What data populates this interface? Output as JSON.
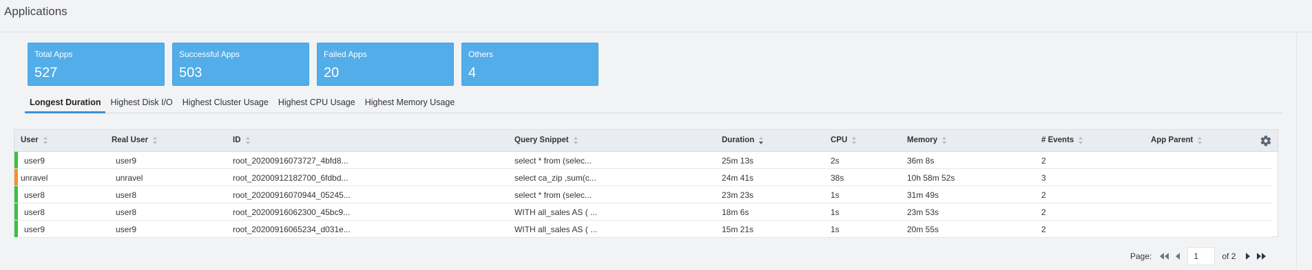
{
  "header": {
    "title": "Applications"
  },
  "cards": [
    {
      "label": "Total Apps",
      "value": "527"
    },
    {
      "label": "Successful Apps",
      "value": "503"
    },
    {
      "label": "Failed Apps",
      "value": "20"
    },
    {
      "label": "Others",
      "value": "4"
    }
  ],
  "tabs": [
    {
      "label": "Longest Duration",
      "active": true
    },
    {
      "label": "Highest Disk I/O",
      "active": false
    },
    {
      "label": "Highest Cluster Usage",
      "active": false
    },
    {
      "label": "Highest CPU Usage",
      "active": false
    },
    {
      "label": "Highest Memory Usage",
      "active": false
    }
  ],
  "table": {
    "columns": [
      "User",
      "Real User",
      "ID",
      "Query Snippet",
      "Duration",
      "CPU",
      "Memory",
      "# Events",
      "App Parent"
    ],
    "sorted_column": "Duration",
    "sort_direction": "descending",
    "rows": [
      {
        "status_color": "#3fbf3f",
        "user": "user9",
        "real_user": "user9",
        "id": "root_20200916073727_4bfd8...",
        "query": "select * from (selec...",
        "duration": "25m 13s",
        "cpu": "2s",
        "memory": "36m 8s",
        "events": "2",
        "app_parent": ""
      },
      {
        "status_color": "#f5922a",
        "user": "unravel",
        "real_user": "unravel",
        "id": "root_20200912182700_6fdbd...",
        "query": "select ca_zip ,sum(c...",
        "duration": "24m 41s",
        "cpu": "38s",
        "memory": "10h 58m 52s",
        "events": "3",
        "app_parent": ""
      },
      {
        "status_color": "#3fbf3f",
        "user": "user8",
        "real_user": "user8",
        "id": "root_20200916070944_05245...",
        "query": "select * from (selec...",
        "duration": "23m 23s",
        "cpu": "1s",
        "memory": "31m 49s",
        "events": "2",
        "app_parent": ""
      },
      {
        "status_color": "#3fbf3f",
        "user": "user8",
        "real_user": "user8",
        "id": "root_20200916062300_45bc9...",
        "query": "WITH all_sales AS ( ...",
        "duration": "18m 6s",
        "cpu": "1s",
        "memory": "23m 53s",
        "events": "2",
        "app_parent": ""
      },
      {
        "status_color": "#3fbf3f",
        "user": "user9",
        "real_user": "user9",
        "id": "root_20200916065234_d031e...",
        "query": "WITH all_sales AS ( ...",
        "duration": "15m 21s",
        "cpu": "1s",
        "memory": "20m 55s",
        "events": "2",
        "app_parent": ""
      }
    ]
  },
  "pager": {
    "label": "Page:",
    "current": "1",
    "of_label": "of 2"
  },
  "icons": {
    "settings": "gear-icon",
    "first": "double-chevron-left-icon",
    "prev": "triangle-left-icon",
    "next": "triangle-right-icon",
    "last": "double-chevron-right-icon"
  },
  "colors": {
    "card_bg": "#52ade9",
    "active_tab": "#3b8fd6",
    "success": "#3fbf3f",
    "warning": "#f5922a"
  }
}
